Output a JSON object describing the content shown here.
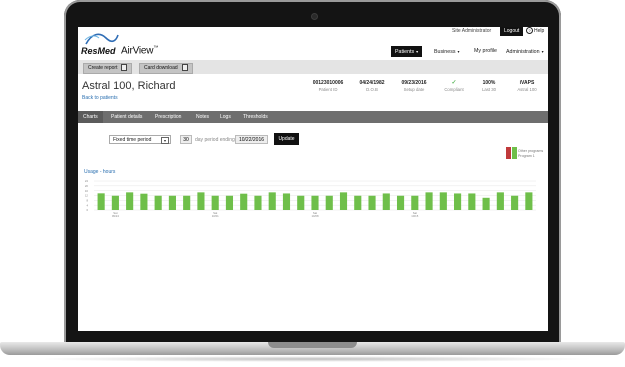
{
  "header": {
    "brand": "ResMed",
    "app_name": "AirView",
    "app_mark": "™",
    "user_link": "Site Administrator",
    "logout_label": "Logout",
    "help_label": "Help"
  },
  "nav": [
    {
      "label": "Patients",
      "active": true,
      "dropdown": true
    },
    {
      "label": "Business",
      "active": false,
      "dropdown": true
    },
    {
      "label": "My profile",
      "active": false,
      "dropdown": false
    },
    {
      "label": "Administration",
      "active": false,
      "dropdown": true
    }
  ],
  "toolbar": {
    "create_report": "Create report",
    "card_download": "Card download"
  },
  "patient": {
    "name": "Astral 100, Richard",
    "back_link": "Back to patients",
    "stats": [
      {
        "value": "00123010006",
        "label": "Patient ID"
      },
      {
        "value": "04/24/1982",
        "label": "D.O.B"
      },
      {
        "value": "09/23/2016",
        "label": "Setup date"
      },
      {
        "value": "✓",
        "label": "Compliant"
      },
      {
        "value": "100%",
        "label": "Last 30"
      },
      {
        "value": "iVAPS",
        "label": "Astral 100"
      }
    ]
  },
  "tabs": [
    "Charts",
    "Patient details",
    "Prescription",
    "Notes",
    "Logs",
    "Thresholds"
  ],
  "active_tab": "Charts",
  "filter": {
    "period": "Fixed time period",
    "days": "30",
    "days_label": "day period ending",
    "end_date": "10/22/2016",
    "update_label": "Update"
  },
  "legend": {
    "line1": "Other programs",
    "line2": "Program 1",
    "colors": {
      "other": "#c0393b",
      "program": "#6fbf4a"
    }
  },
  "chart_data": {
    "type": "bar",
    "title": "Usage - hours",
    "ylim": [
      0,
      24
    ],
    "yticks": [
      0,
      4,
      8,
      12,
      16,
      20,
      24
    ],
    "grid": true,
    "legend_position": "top-right",
    "series": [
      {
        "name": "Program 1",
        "color": "#6fbf4a",
        "values": [
          13.8,
          11.8,
          14.6,
          13.5,
          11.8,
          11.8,
          11.8,
          14.6,
          11.8,
          11.8,
          13.5,
          11.8,
          14.6,
          13.7,
          11.8,
          11.8,
          11.8,
          14.6,
          11.8,
          11.8,
          13.7,
          11.8,
          11.8,
          14.6,
          14.6,
          13.7,
          13.7,
          10.1,
          14.6,
          11.8,
          14.6
        ]
      }
    ],
    "x_tick_labels": [
      "Sat\n09/24",
      "Sat\n10/01",
      "Sat\n10/08",
      "Sat\n10/15"
    ],
    "x_tick_indices": [
      1,
      8,
      15,
      22
    ]
  }
}
